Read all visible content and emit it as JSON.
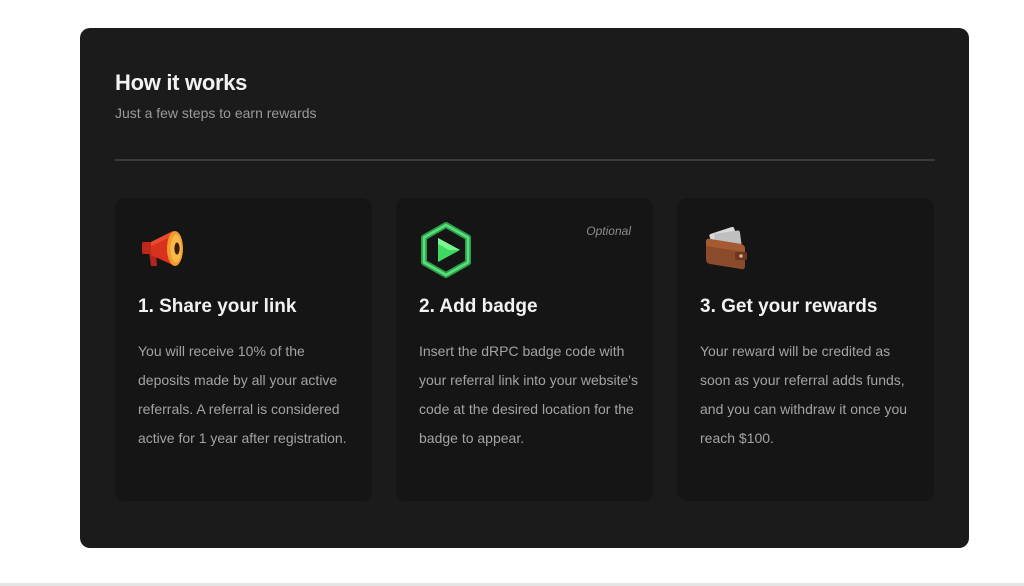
{
  "section": {
    "title": "How it works",
    "subtitle": "Just a few steps to earn rewards"
  },
  "steps": [
    {
      "icon": "megaphone-icon",
      "title": "1. Share your link",
      "text": "You will receive 10% of the deposits made by all your active referrals. A referral is considered active for 1 year after registration."
    },
    {
      "icon": "drpc-badge-icon",
      "tag": "Optional",
      "title": "2. Add badge",
      "text": "Insert the dRPC badge code with your referral link into your website's code at the desired location for the badge to appear."
    },
    {
      "icon": "wallet-icon",
      "title": "3. Get your rewards",
      "text": "Your reward will be credited as soon as your referral adds funds, and you can withdraw it once you reach $100."
    }
  ],
  "colors": {
    "panel_bg": "#1b1b1c",
    "card_bg": "#151515",
    "badge_green": "#3ddc5f",
    "megaphone_orange": "#f08a24",
    "wallet_brown": "#8b4a2b"
  }
}
